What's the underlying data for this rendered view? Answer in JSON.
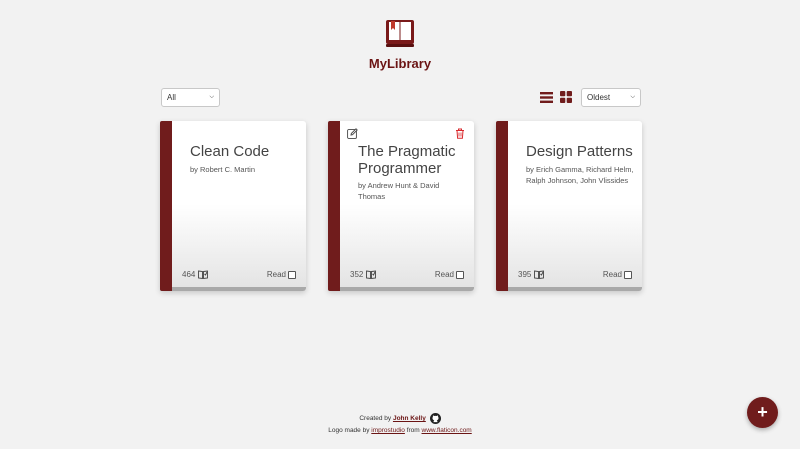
{
  "app": {
    "title": "MyLibrary",
    "accent": "#701c1c"
  },
  "toolbar": {
    "filter_value": "All",
    "sort_value": "Oldest"
  },
  "books": [
    {
      "title": "Clean Code",
      "author": "by Robert C. Martin",
      "pages": "464",
      "read_label": "Read"
    },
    {
      "title": "The Pragmatic Programmer",
      "author": "by Andrew Hunt & David Thomas",
      "pages": "352",
      "read_label": "Read"
    },
    {
      "title": "Design Patterns",
      "author": "by Erich Gamma, Richard Helm, Ralph Johnson, John Vlissides",
      "pages": "395",
      "read_label": "Read"
    }
  ],
  "footer": {
    "created_prefix": "Created by",
    "author_link": "John Kelly",
    "logo_prefix": "Logo made by",
    "logo_author": "improstudio",
    "logo_from": "from",
    "logo_site": "www.flaticon.com"
  },
  "fab": {
    "label": "+"
  }
}
